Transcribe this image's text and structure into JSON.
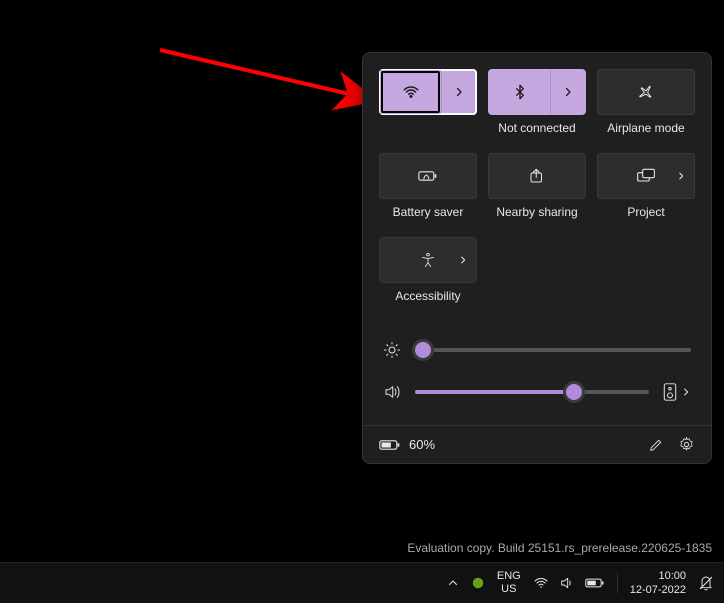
{
  "colors": {
    "accent": "#b08cd9",
    "tile_active": "#c5a8e0",
    "panel_bg": "#1f1f1f"
  },
  "annotation": {
    "arrow_target": "wifi-tile"
  },
  "quick_settings": {
    "tiles": {
      "wifi": {
        "label": "",
        "active": true,
        "expandable": true,
        "highlighted": true
      },
      "bluetooth": {
        "label": "Not connected",
        "active": true,
        "expandable": true
      },
      "airplane": {
        "label": "Airplane mode",
        "active": false
      },
      "battery_saver": {
        "label": "Battery saver",
        "active": false
      },
      "nearby_sharing": {
        "label": "Nearby sharing",
        "active": false
      },
      "project": {
        "label": "Project",
        "active": false,
        "inner_expand": true
      },
      "accessibility": {
        "label": "Accessibility",
        "active": false,
        "inner_expand": true
      }
    },
    "brightness": {
      "value_pct": 3
    },
    "volume": {
      "value_pct": 68
    },
    "battery": {
      "display": "60%"
    }
  },
  "watermark": "Evaluation copy. Build 25151.rs_prerelease.220625-1835",
  "taskbar": {
    "lang_top": "ENG",
    "lang_bottom": "US",
    "time": "10:00",
    "date": "12-07-2022"
  }
}
